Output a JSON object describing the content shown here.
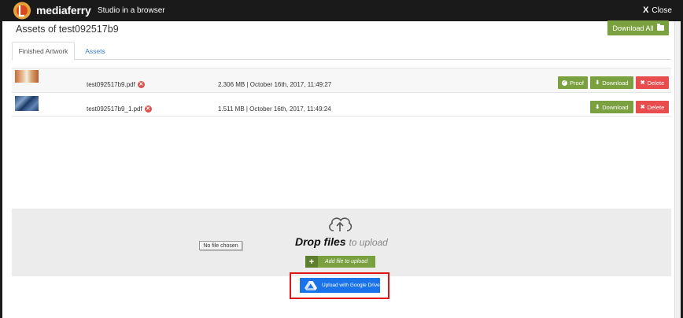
{
  "app": {
    "brand": "mediaferry",
    "tagline": "Studio in a browser",
    "close_label": "Close"
  },
  "header": {
    "title": "Assets of test092517b9",
    "download_all_label": "Download All"
  },
  "tabs": [
    {
      "label": "Finished Artwork",
      "active": true
    },
    {
      "label": "Assets",
      "active": false
    }
  ],
  "files": [
    {
      "name": "test092517b9.pdf",
      "meta": "2.306 MB | October 16th, 2017, 11:49:27",
      "buttons": {
        "proof": "Proof",
        "download": "Download",
        "delete": "Delete"
      }
    },
    {
      "name": "test092517b9_1.pdf",
      "meta": "1.511 MB | October 16th, 2017, 11:49:24",
      "buttons": {
        "download": "Download",
        "delete": "Delete"
      }
    }
  ],
  "upload": {
    "drop_strong": "Drop files",
    "drop_sub": "to upload",
    "no_file_label": "No file chosen",
    "add_file_label": "Add file to upload",
    "gdrive_label": "Upload with Google Drive"
  },
  "colors": {
    "topbar": "#1a1a1a",
    "accent_green": "#7aa03f",
    "delete_red": "#e84c4c",
    "gdrive_blue": "#1a73e8",
    "highlight_red": "#e01515"
  }
}
